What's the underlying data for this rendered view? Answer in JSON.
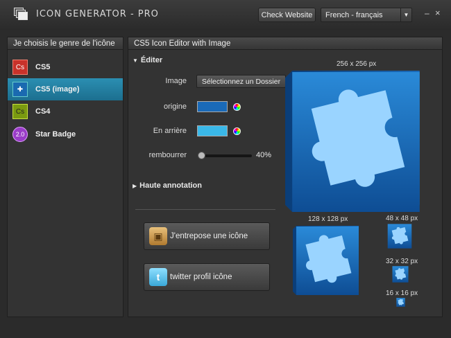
{
  "window": {
    "title": "ICON GENERATOR - PRO",
    "check_website": "Check Website",
    "language": "French - français",
    "minimize": "–",
    "close": "×"
  },
  "sidebar": {
    "header": "Je choisis le genre de l'icône",
    "items": [
      {
        "label": "CS5",
        "icon": "cs5-icon",
        "badge": "Cs",
        "active": false
      },
      {
        "label": "CS5 (image)",
        "icon": "puzzle-icon",
        "badge": "✚",
        "active": true
      },
      {
        "label": "CS4",
        "icon": "cs4-icon",
        "badge": "Cs",
        "active": false
      },
      {
        "label": "Star Badge",
        "icon": "star-badge-icon",
        "badge": "2.0",
        "active": false
      }
    ]
  },
  "editor": {
    "header": "CS5 Icon Editor with Image",
    "section_edit": "Éditer",
    "image_label": "Image",
    "image_button": "Sélectionnez un Dossier",
    "origin_label": "origine",
    "background_label": "En arrière",
    "padding_label": "rembourrer",
    "padding_value": "40%",
    "padding_fraction": 0.0,
    "section_annotation": "Haute annotation",
    "origin_color": "#1a6ab8",
    "background_color": "#3ab8e8",
    "save_button": "J'entrepose une icône",
    "twitter_button": "twitter profil icône"
  },
  "previews": {
    "size_256": "256 x 256 px",
    "size_128": "128 x 128 px",
    "size_48": "48 x 48 px",
    "size_32": "32 x 32 px",
    "size_16": "16 x 16 px"
  }
}
